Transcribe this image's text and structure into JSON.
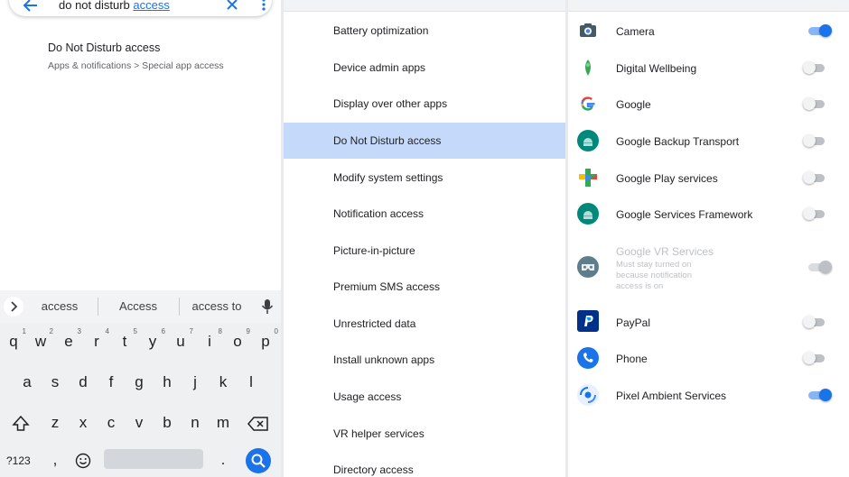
{
  "search": {
    "query_prefix": "do not disturb ",
    "query_selected": "access",
    "result_title": "Do Not Disturb access",
    "result_path": "Apps & notifications > Special app access"
  },
  "keyboard": {
    "suggestions": [
      "access",
      "Access",
      "access to"
    ],
    "row1": [
      {
        "k": "q",
        "n": "1"
      },
      {
        "k": "w",
        "n": "2"
      },
      {
        "k": "e",
        "n": "3"
      },
      {
        "k": "r",
        "n": "4"
      },
      {
        "k": "t",
        "n": "5"
      },
      {
        "k": "y",
        "n": "6"
      },
      {
        "k": "u",
        "n": "7"
      },
      {
        "k": "i",
        "n": "8"
      },
      {
        "k": "o",
        "n": "9"
      },
      {
        "k": "p",
        "n": "0"
      }
    ],
    "row2": [
      "a",
      "s",
      "d",
      "f",
      "g",
      "h",
      "j",
      "k",
      "l"
    ],
    "row3": [
      "z",
      "x",
      "c",
      "v",
      "b",
      "n",
      "m"
    ],
    "symbols_key": "?123",
    "comma_key": ",",
    "period_key": "."
  },
  "special_access": {
    "items": [
      "Battery optimization",
      "Device admin apps",
      "Display over other apps",
      "Do Not Disturb access",
      "Modify system settings",
      "Notification access",
      "Picture-in-picture",
      "Premium SMS access",
      "Unrestricted data",
      "Install unknown apps",
      "Usage access",
      "VR helper services",
      "Directory access"
    ],
    "selected": "Do Not Disturb access"
  },
  "dnd_apps": {
    "accent": "#1a73e8",
    "apps": [
      {
        "name": "Camera",
        "icon": "camera-icon",
        "state": "on"
      },
      {
        "name": "Digital Wellbeing",
        "icon": "digital-wellbeing-icon",
        "state": "off"
      },
      {
        "name": "Google",
        "icon": "google-icon",
        "state": "off"
      },
      {
        "name": "Google Backup Transport",
        "icon": "android-icon",
        "state": "off"
      },
      {
        "name": "Google Play services",
        "icon": "play-services-icon",
        "state": "off"
      },
      {
        "name": "Google Services Framework",
        "icon": "android-icon",
        "state": "off"
      },
      {
        "name": "Google VR Services",
        "icon": "vr-headset-icon",
        "state": "disabled",
        "note": [
          "Must stay turned on",
          "because notification",
          "access is on"
        ]
      },
      {
        "name": "PayPal",
        "icon": "paypal-icon",
        "state": "off"
      },
      {
        "name": "Phone",
        "icon": "phone-icon",
        "state": "off"
      },
      {
        "name": "Pixel Ambient Services",
        "icon": "pixel-ambient-icon",
        "state": "on"
      }
    ]
  }
}
